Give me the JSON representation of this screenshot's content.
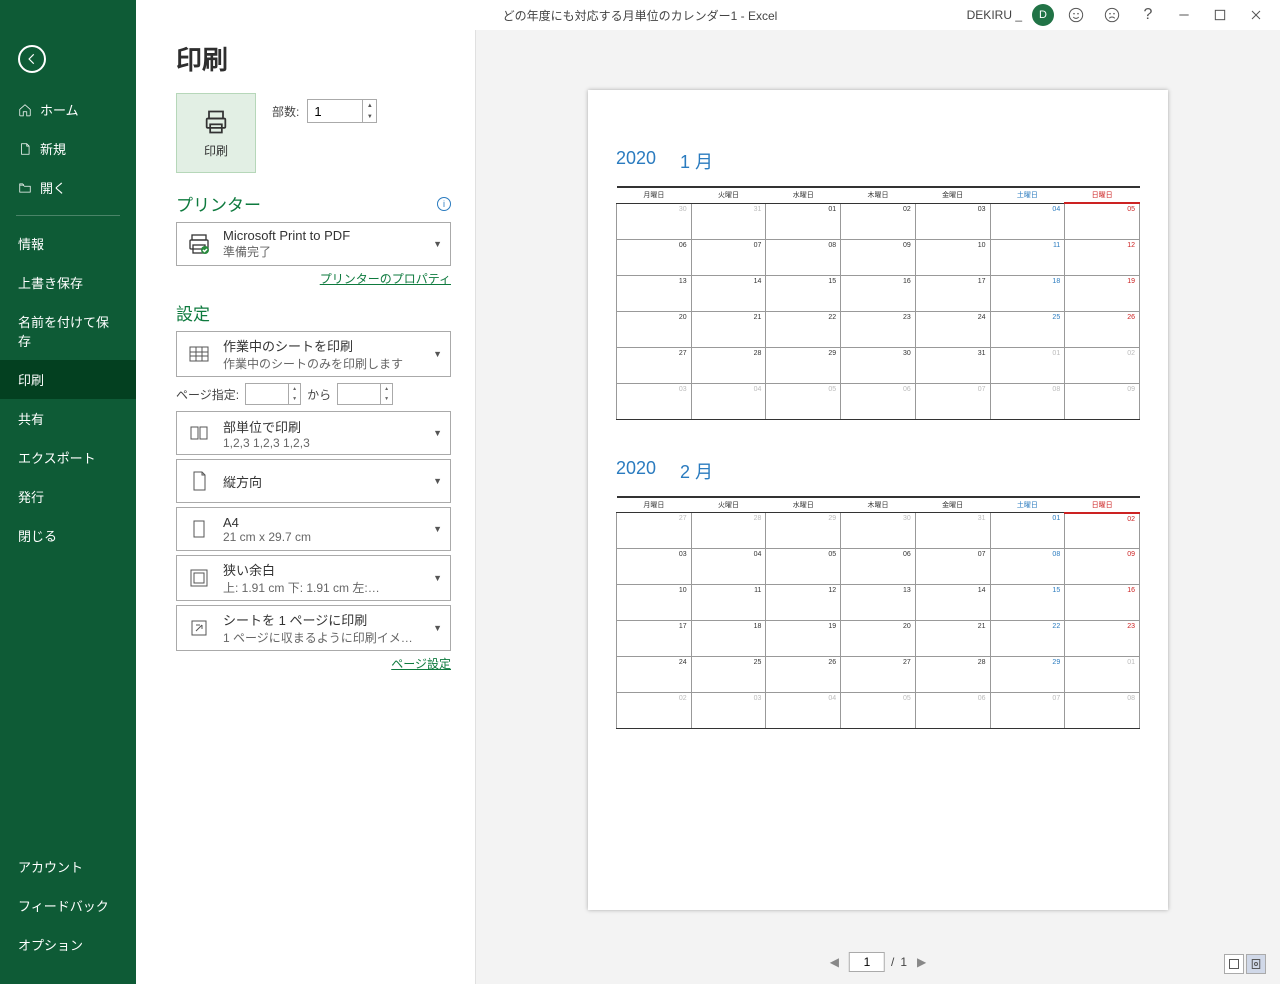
{
  "title": "どの年度にも対応する月単位のカレンダー1  -  Excel",
  "user": {
    "name": "DEKIRU _",
    "initial": "D"
  },
  "page_heading": "印刷",
  "sidebar": {
    "top": [
      {
        "label": "ホーム",
        "icon": "home"
      },
      {
        "label": "新規",
        "icon": "new"
      },
      {
        "label": "開く",
        "icon": "open"
      }
    ],
    "mid": [
      {
        "label": "情報"
      },
      {
        "label": "上書き保存"
      },
      {
        "label": "名前を付けて保存"
      },
      {
        "label": "印刷",
        "active": true
      },
      {
        "label": "共有"
      },
      {
        "label": "エクスポート"
      },
      {
        "label": "発行"
      },
      {
        "label": "閉じる"
      }
    ],
    "bottom": [
      {
        "label": "アカウント"
      },
      {
        "label": "フィードバック"
      },
      {
        "label": "オプション"
      }
    ]
  },
  "print_button_label": "印刷",
  "copies": {
    "label": "部数:",
    "value": "1"
  },
  "printer_section": "プリンター",
  "printer": {
    "name": "Microsoft Print to PDF",
    "status": "準備完了"
  },
  "printer_props_link": "プリンターのプロパティ",
  "settings_section": "設定",
  "settings": {
    "what": {
      "title": "作業中のシートを印刷",
      "sub": "作業中のシートのみを印刷します"
    },
    "page_range": {
      "label": "ページ指定:",
      "sep": "から"
    },
    "collate": {
      "title": "部単位で印刷",
      "sub": "1,2,3    1,2,3    1,2,3"
    },
    "orientation": {
      "title": "縦方向"
    },
    "paper": {
      "title": "A4",
      "sub": "21 cm x 29.7 cm"
    },
    "margins": {
      "title": "狭い余白",
      "sub": "上: 1.91 cm 下: 1.91 cm 左:…"
    },
    "scaling": {
      "title": "シートを 1 ページに印刷",
      "sub": "1 ページに収まるように印刷イメ…"
    }
  },
  "page_setup_link": "ページ設定",
  "preview": {
    "current_page": "1",
    "total_pages": "1",
    "sep": "/",
    "months": [
      {
        "year": "2020",
        "month": "1 月",
        "headers": [
          "月曜日",
          "火曜日",
          "水曜日",
          "木曜日",
          "金曜日",
          "土曜日",
          "日曜日"
        ],
        "rows": [
          [
            {
              "d": "30",
              "o": 1
            },
            {
              "d": "31",
              "o": 1
            },
            {
              "d": "01"
            },
            {
              "d": "02"
            },
            {
              "d": "03"
            },
            {
              "d": "04",
              "sat": 1
            },
            {
              "d": "05",
              "sun": 1
            }
          ],
          [
            {
              "d": "06"
            },
            {
              "d": "07"
            },
            {
              "d": "08"
            },
            {
              "d": "09"
            },
            {
              "d": "10"
            },
            {
              "d": "11",
              "sat": 1
            },
            {
              "d": "12",
              "sun": 1
            }
          ],
          [
            {
              "d": "13"
            },
            {
              "d": "14"
            },
            {
              "d": "15"
            },
            {
              "d": "16"
            },
            {
              "d": "17"
            },
            {
              "d": "18",
              "sat": 1
            },
            {
              "d": "19",
              "sun": 1
            }
          ],
          [
            {
              "d": "20"
            },
            {
              "d": "21"
            },
            {
              "d": "22"
            },
            {
              "d": "23"
            },
            {
              "d": "24"
            },
            {
              "d": "25",
              "sat": 1
            },
            {
              "d": "26",
              "sun": 1
            }
          ],
          [
            {
              "d": "27"
            },
            {
              "d": "28"
            },
            {
              "d": "29"
            },
            {
              "d": "30"
            },
            {
              "d": "31"
            },
            {
              "d": "01",
              "o": 1
            },
            {
              "d": "02",
              "o": 1
            }
          ],
          [
            {
              "d": "03",
              "o": 1
            },
            {
              "d": "04",
              "o": 1
            },
            {
              "d": "05",
              "o": 1
            },
            {
              "d": "06",
              "o": 1
            },
            {
              "d": "07",
              "o": 1
            },
            {
              "d": "08",
              "o": 1
            },
            {
              "d": "09",
              "o": 1
            }
          ]
        ]
      },
      {
        "year": "2020",
        "month": "2 月",
        "headers": [
          "月曜日",
          "火曜日",
          "水曜日",
          "木曜日",
          "金曜日",
          "土曜日",
          "日曜日"
        ],
        "rows": [
          [
            {
              "d": "27",
              "o": 1
            },
            {
              "d": "28",
              "o": 1
            },
            {
              "d": "29",
              "o": 1
            },
            {
              "d": "30",
              "o": 1
            },
            {
              "d": "31",
              "o": 1
            },
            {
              "d": "01",
              "sat": 1
            },
            {
              "d": "02",
              "sun": 1
            }
          ],
          [
            {
              "d": "03"
            },
            {
              "d": "04"
            },
            {
              "d": "05"
            },
            {
              "d": "06"
            },
            {
              "d": "07"
            },
            {
              "d": "08",
              "sat": 1
            },
            {
              "d": "09",
              "sun": 1
            }
          ],
          [
            {
              "d": "10"
            },
            {
              "d": "11"
            },
            {
              "d": "12"
            },
            {
              "d": "13"
            },
            {
              "d": "14"
            },
            {
              "d": "15",
              "sat": 1
            },
            {
              "d": "16",
              "sun": 1
            }
          ],
          [
            {
              "d": "17"
            },
            {
              "d": "18"
            },
            {
              "d": "19"
            },
            {
              "d": "20"
            },
            {
              "d": "21"
            },
            {
              "d": "22",
              "sat": 1
            },
            {
              "d": "23",
              "sun": 1
            }
          ],
          [
            {
              "d": "24"
            },
            {
              "d": "25"
            },
            {
              "d": "26"
            },
            {
              "d": "27"
            },
            {
              "d": "28"
            },
            {
              "d": "29",
              "sat": 1
            },
            {
              "d": "01",
              "o": 1
            }
          ],
          [
            {
              "d": "02",
              "o": 1
            },
            {
              "d": "03",
              "o": 1
            },
            {
              "d": "04",
              "o": 1
            },
            {
              "d": "05",
              "o": 1
            },
            {
              "d": "06",
              "o": 1
            },
            {
              "d": "07",
              "o": 1
            },
            {
              "d": "08",
              "o": 1
            }
          ]
        ]
      }
    ]
  }
}
